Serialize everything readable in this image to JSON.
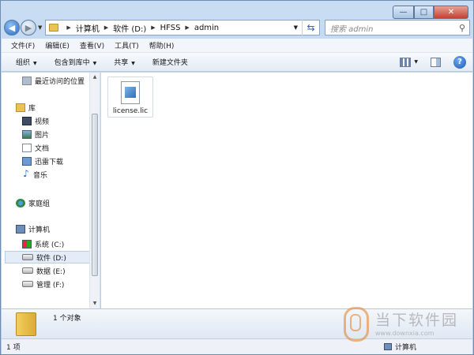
{
  "window": {
    "controls": {
      "minimize": "—",
      "maximize": "□",
      "close": "✕"
    }
  },
  "address": {
    "path": [
      "计算机",
      "软件 (D:)",
      "HFSS",
      "admin"
    ],
    "search_placeholder": "搜索 admin"
  },
  "menu": [
    "文件(F)",
    "编辑(E)",
    "查看(V)",
    "工具(T)",
    "帮助(H)"
  ],
  "commands": [
    "组织",
    "包含到库中",
    "共享",
    "新建文件夹"
  ],
  "nav": {
    "recent": "最近访问的位置",
    "libraries": "库",
    "video": "视频",
    "pictures": "图片",
    "documents": "文档",
    "downloads": "迅雷下载",
    "music": "音乐",
    "homegroup": "家庭组",
    "computer": "计算机",
    "drives": [
      "系统 (C:)",
      "软件 (D:)",
      "数据 (E:)",
      "管理 (F:)"
    ]
  },
  "content": {
    "files": [
      {
        "name": "license.lic",
        "icon": "lic-file-icon"
      }
    ]
  },
  "details": {
    "count": "1 个对象"
  },
  "status": {
    "items": "1 项",
    "zone": "计算机"
  },
  "watermark": {
    "name": "当下软件园",
    "url": "www.downxia.com"
  },
  "colors": {
    "chrome": "#c8dcf2",
    "selection": "#e3ecf7",
    "accent": "#2a66b5"
  }
}
